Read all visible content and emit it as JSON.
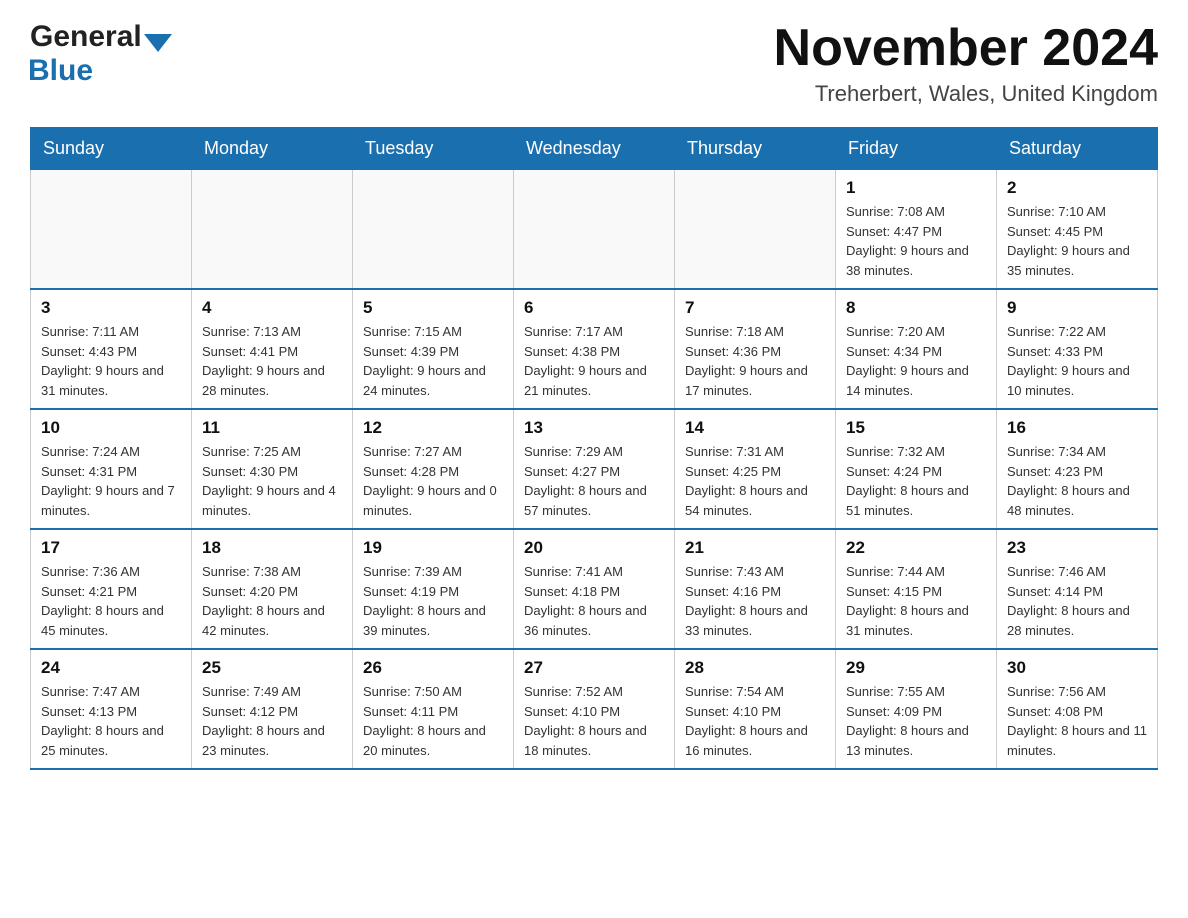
{
  "header": {
    "logo_general": "General",
    "logo_blue": "Blue",
    "month_title": "November 2024",
    "location": "Treherbert, Wales, United Kingdom"
  },
  "days_of_week": [
    "Sunday",
    "Monday",
    "Tuesday",
    "Wednesday",
    "Thursday",
    "Friday",
    "Saturday"
  ],
  "weeks": [
    [
      {
        "day": "",
        "info": ""
      },
      {
        "day": "",
        "info": ""
      },
      {
        "day": "",
        "info": ""
      },
      {
        "day": "",
        "info": ""
      },
      {
        "day": "",
        "info": ""
      },
      {
        "day": "1",
        "info": "Sunrise: 7:08 AM\nSunset: 4:47 PM\nDaylight: 9 hours and 38 minutes."
      },
      {
        "day": "2",
        "info": "Sunrise: 7:10 AM\nSunset: 4:45 PM\nDaylight: 9 hours and 35 minutes."
      }
    ],
    [
      {
        "day": "3",
        "info": "Sunrise: 7:11 AM\nSunset: 4:43 PM\nDaylight: 9 hours and 31 minutes."
      },
      {
        "day": "4",
        "info": "Sunrise: 7:13 AM\nSunset: 4:41 PM\nDaylight: 9 hours and 28 minutes."
      },
      {
        "day": "5",
        "info": "Sunrise: 7:15 AM\nSunset: 4:39 PM\nDaylight: 9 hours and 24 minutes."
      },
      {
        "day": "6",
        "info": "Sunrise: 7:17 AM\nSunset: 4:38 PM\nDaylight: 9 hours and 21 minutes."
      },
      {
        "day": "7",
        "info": "Sunrise: 7:18 AM\nSunset: 4:36 PM\nDaylight: 9 hours and 17 minutes."
      },
      {
        "day": "8",
        "info": "Sunrise: 7:20 AM\nSunset: 4:34 PM\nDaylight: 9 hours and 14 minutes."
      },
      {
        "day": "9",
        "info": "Sunrise: 7:22 AM\nSunset: 4:33 PM\nDaylight: 9 hours and 10 minutes."
      }
    ],
    [
      {
        "day": "10",
        "info": "Sunrise: 7:24 AM\nSunset: 4:31 PM\nDaylight: 9 hours and 7 minutes."
      },
      {
        "day": "11",
        "info": "Sunrise: 7:25 AM\nSunset: 4:30 PM\nDaylight: 9 hours and 4 minutes."
      },
      {
        "day": "12",
        "info": "Sunrise: 7:27 AM\nSunset: 4:28 PM\nDaylight: 9 hours and 0 minutes."
      },
      {
        "day": "13",
        "info": "Sunrise: 7:29 AM\nSunset: 4:27 PM\nDaylight: 8 hours and 57 minutes."
      },
      {
        "day": "14",
        "info": "Sunrise: 7:31 AM\nSunset: 4:25 PM\nDaylight: 8 hours and 54 minutes."
      },
      {
        "day": "15",
        "info": "Sunrise: 7:32 AM\nSunset: 4:24 PM\nDaylight: 8 hours and 51 minutes."
      },
      {
        "day": "16",
        "info": "Sunrise: 7:34 AM\nSunset: 4:23 PM\nDaylight: 8 hours and 48 minutes."
      }
    ],
    [
      {
        "day": "17",
        "info": "Sunrise: 7:36 AM\nSunset: 4:21 PM\nDaylight: 8 hours and 45 minutes."
      },
      {
        "day": "18",
        "info": "Sunrise: 7:38 AM\nSunset: 4:20 PM\nDaylight: 8 hours and 42 minutes."
      },
      {
        "day": "19",
        "info": "Sunrise: 7:39 AM\nSunset: 4:19 PM\nDaylight: 8 hours and 39 minutes."
      },
      {
        "day": "20",
        "info": "Sunrise: 7:41 AM\nSunset: 4:18 PM\nDaylight: 8 hours and 36 minutes."
      },
      {
        "day": "21",
        "info": "Sunrise: 7:43 AM\nSunset: 4:16 PM\nDaylight: 8 hours and 33 minutes."
      },
      {
        "day": "22",
        "info": "Sunrise: 7:44 AM\nSunset: 4:15 PM\nDaylight: 8 hours and 31 minutes."
      },
      {
        "day": "23",
        "info": "Sunrise: 7:46 AM\nSunset: 4:14 PM\nDaylight: 8 hours and 28 minutes."
      }
    ],
    [
      {
        "day": "24",
        "info": "Sunrise: 7:47 AM\nSunset: 4:13 PM\nDaylight: 8 hours and 25 minutes."
      },
      {
        "day": "25",
        "info": "Sunrise: 7:49 AM\nSunset: 4:12 PM\nDaylight: 8 hours and 23 minutes."
      },
      {
        "day": "26",
        "info": "Sunrise: 7:50 AM\nSunset: 4:11 PM\nDaylight: 8 hours and 20 minutes."
      },
      {
        "day": "27",
        "info": "Sunrise: 7:52 AM\nSunset: 4:10 PM\nDaylight: 8 hours and 18 minutes."
      },
      {
        "day": "28",
        "info": "Sunrise: 7:54 AM\nSunset: 4:10 PM\nDaylight: 8 hours and 16 minutes."
      },
      {
        "day": "29",
        "info": "Sunrise: 7:55 AM\nSunset: 4:09 PM\nDaylight: 8 hours and 13 minutes."
      },
      {
        "day": "30",
        "info": "Sunrise: 7:56 AM\nSunset: 4:08 PM\nDaylight: 8 hours and 11 minutes."
      }
    ]
  ]
}
